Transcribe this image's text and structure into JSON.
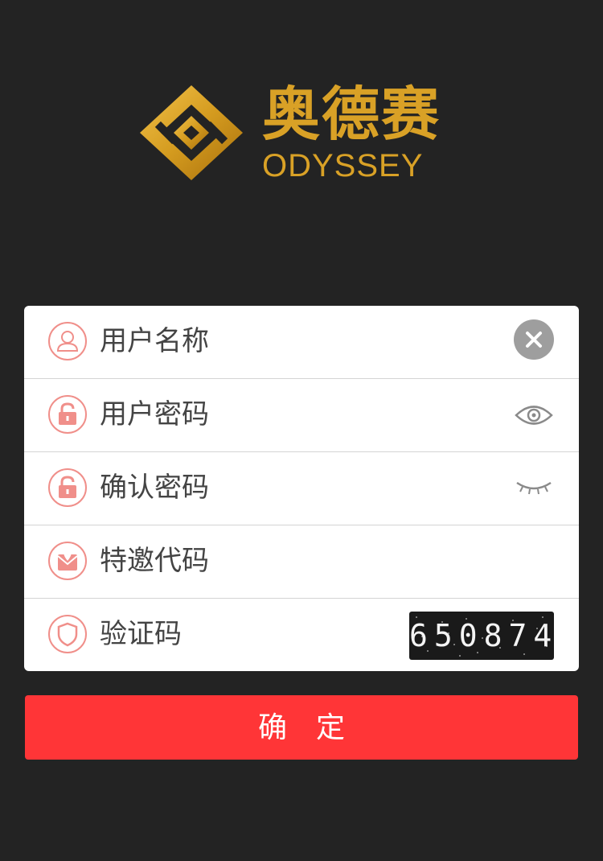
{
  "brand": {
    "name_cn": "奥德赛",
    "name_en": "ODYSSEY",
    "color": "#d9a126",
    "logo_icon": "diamond-knot-logo"
  },
  "form": {
    "username": {
      "placeholder": "用户名称",
      "icon": "user-icon",
      "action_icon": "clear-icon"
    },
    "password": {
      "placeholder": "用户密码",
      "icon": "lock-icon",
      "action_icon": "eye-open-icon"
    },
    "confirm_password": {
      "placeholder": "确认密码",
      "icon": "lock-icon",
      "action_icon": "eye-closed-icon"
    },
    "invite_code": {
      "placeholder": "特邀代码",
      "icon": "envelope-heart-icon"
    },
    "captcha": {
      "placeholder": "验证码",
      "icon": "shield-icon",
      "code": "650874"
    }
  },
  "submit": {
    "label": "确定"
  },
  "colors": {
    "background": "#232323",
    "accent_red": "#ff3537",
    "icon_pink": "#f08f8a",
    "gold": "#d9a126"
  }
}
